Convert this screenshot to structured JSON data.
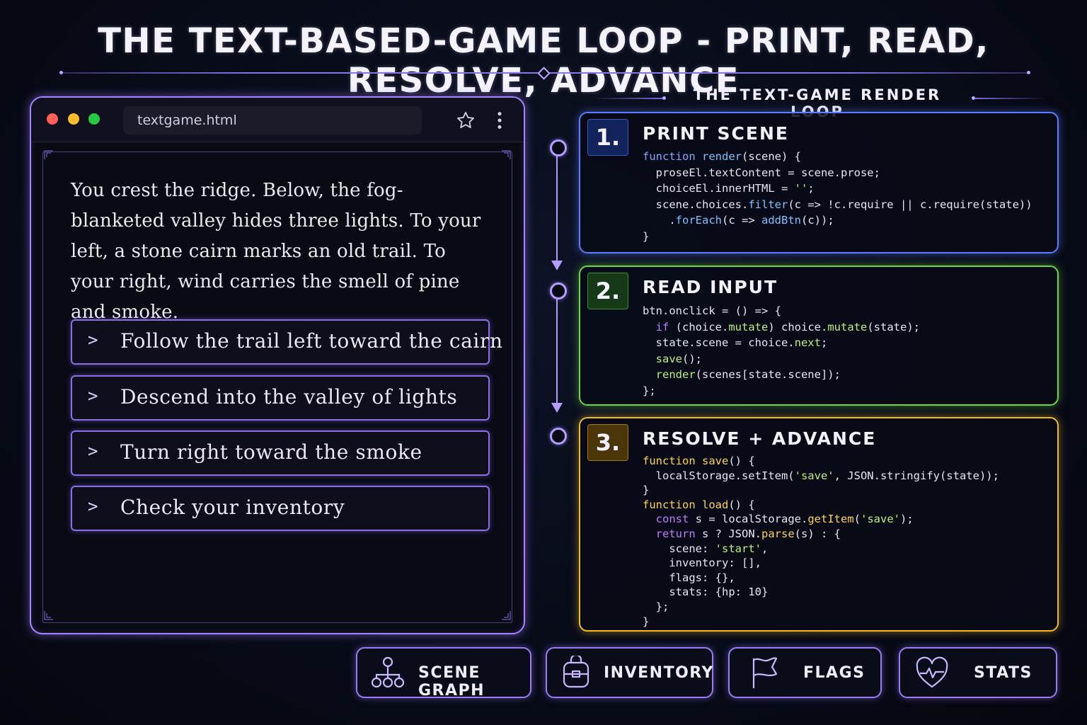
{
  "title": "THE TEXT-BASED-GAME LOOP - PRINT, READ, RESOLVE, ADVANCE",
  "browser": {
    "address": "textgame.html",
    "story_text": "You crest the ridge. Below, the fog-blanketed valley hides three lights. To your left, a stone cairn marks an old trail. To your right, wind carries the smell of pine and smoke.",
    "caret": ">",
    "choices": [
      "Follow the trail left toward the cairn",
      "Descend into the valley of lights",
      "Turn right toward the smoke",
      "Check your inventory"
    ]
  },
  "loop": {
    "header": "THE TEXT-GAME RENDER LOOP",
    "steps": [
      {
        "number": "1.",
        "title": "PRINT SCENE",
        "color": "#5b7dff",
        "code_lines": [
          "function render(scene) {",
          "  proseEl.textContent = scene.prose;",
          "  choiceEl.innerHTML = '';",
          "  scene.choices.filter(c => !c.require || c.require(state))",
          "    .forEach(c => addBtn(c));",
          "}"
        ]
      },
      {
        "number": "2.",
        "title": "READ INPUT",
        "color": "#6fd64a",
        "code_lines": [
          "btn.onclick = () => {",
          "  if (choice.mutate) choice.mutate(state);",
          "  state.scene = choice.next;",
          "  save();",
          "  render(scenes[state.scene]);",
          "};"
        ]
      },
      {
        "number": "3.",
        "title": "RESOLVE + ADVANCE",
        "color": "#f0b92a",
        "code_lines": [
          "function save() {",
          "  localStorage.setItem('save', JSON.stringify(state));",
          "}",
          "function load() {",
          "  const s = localStorage.getItem('save');",
          "  return s ? JSON.parse(s) : {",
          "    scene: 'start',",
          "    inventory: [],",
          "    flags: {},",
          "    stats: {hp: 10}",
          "  };",
          "}"
        ]
      }
    ]
  },
  "bottom_buttons": [
    {
      "label": "SCENE GRAPH",
      "icon": "scene-graph-icon"
    },
    {
      "label": "INVENTORY",
      "icon": "backpack-icon"
    },
    {
      "label": "FLAGS",
      "icon": "flag-icon"
    },
    {
      "label": "STATS",
      "icon": "heart-pulse-icon"
    }
  ]
}
